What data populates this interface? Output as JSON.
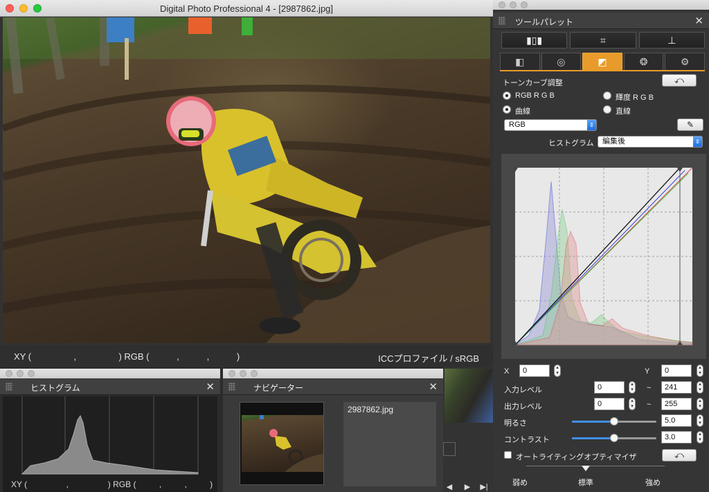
{
  "main_window": {
    "title": "Digital Photo Professional 4 - [2987862.jpg]",
    "status_xy": "XY (                 ,                 ) RGB (           ,           ,           )",
    "status_icc": "ICCプロファイル / sRGB"
  },
  "tool_palette": {
    "title": "ツールパレット",
    "close": "✕",
    "tool_icons": [
      "▮▯▮",
      "⌗",
      "⊥"
    ],
    "tabs": [
      {
        "icon": "◧",
        "name": "tab-basic"
      },
      {
        "icon": "◎",
        "name": "tab-nr"
      },
      {
        "icon": "◩",
        "name": "tab-tone"
      },
      {
        "icon": "❂",
        "name": "tab-color"
      },
      {
        "icon": "⚙",
        "name": "tab-settings"
      }
    ],
    "tone_curve": {
      "heading": "トーンカーブ調整",
      "reset": "⤺",
      "mode_rgb": "RGB R G B",
      "mode_luma": "輝度 R G B",
      "curve": "曲線",
      "straight": "直線",
      "channel": "RGB",
      "histogram_label": "ヒストグラム",
      "histogram_value": "編集後"
    },
    "fields": {
      "x_label": "X",
      "x_value": "0",
      "y_label": "Y",
      "y_value": "0",
      "input_label": "入力レベル",
      "input_min": "0",
      "input_max": "241",
      "output_label": "出力レベル",
      "output_min": "0",
      "output_max": "255",
      "tilde": "~",
      "brightness_label": "明るさ",
      "brightness_value": "5.0",
      "brightness_level": 0.5,
      "contrast_label": "コントラスト",
      "contrast_value": "3.0",
      "contrast_level": 0.5,
      "alo_label": "オートライティングオプティマイザ",
      "alo_reset": "⤺",
      "alo_low": "弱め",
      "alo_std": "標準",
      "alo_high": "強め"
    }
  },
  "histogram_panel": {
    "title": "ヒストグラム",
    "close": "✕",
    "status": "XY (                 ,                 ) RGB (          ,          ,          )"
  },
  "navigator_panel": {
    "title": "ナビゲーター",
    "close": "✕",
    "filename": "2987862.jpg"
  },
  "colors": {
    "accent_tab": "#e89b2a",
    "slider_fill": "#3f8ff0",
    "curve_red": "#e0404a",
    "curve_green": "#3cc24a",
    "curve_blue": "#3a40d8"
  }
}
